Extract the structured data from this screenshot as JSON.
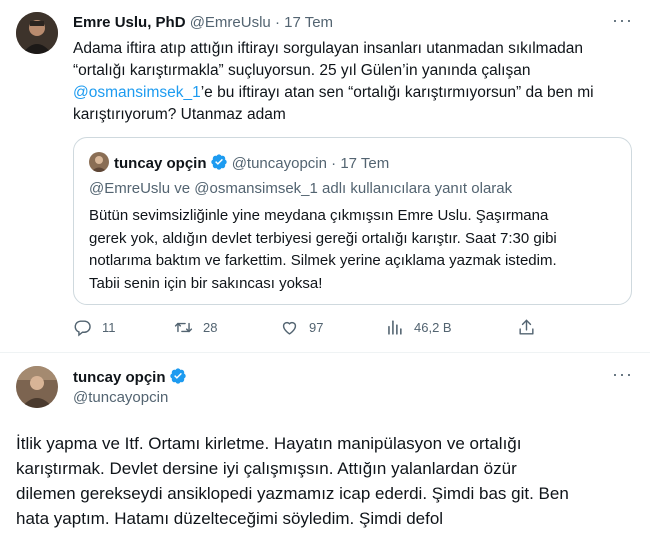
{
  "tweet": {
    "author_name": "Emre Uslu, PhD",
    "author_handle": "@EmreUslu",
    "sep": "·",
    "date": "17 Tem",
    "more": "···",
    "text_line1": "Adama iftira atıp attığın iftirayı sorgulayan insanları utanmadan sıkılmadan",
    "text_line2": "“ortalığı karıştırmakla” suçluyorsun. 25 yıl Gülen’in yanında çalışan",
    "text_mention": "@osmansimsek_1",
    "text_line3_rest": "’e bu iftirayı atan sen “ortalığı karıştırmıyorsun” da ben mi",
    "text_line4": "karıştırıyorum?  Utanmaz adam"
  },
  "quote": {
    "author_name": "tuncay opçin",
    "author_handle": "@tuncayopcin",
    "sep": "·",
    "date": "17 Tem",
    "reply_to": "@EmreUslu ve @osmansimsek_1 adlı kullanıcılara yanıt olarak",
    "line1": "Bütün sevimsizliğinle yine meydana çıkmışsın Emre Uslu. Şaşırmana",
    "line2": "gerek yok, aldığın devlet terbiyesi gereği ortalığı karıştır. Saat 7:30 gibi",
    "line3": "notlarıma baktım ve farkettim. Silmek yerine açıklama yazmak istedim.",
    "line4": "Tabii senin için bir sakıncası yoksa!"
  },
  "actions": {
    "replies": "11",
    "retweets": "28",
    "likes": "97",
    "views": "46,2 B"
  },
  "main": {
    "author_name": "tuncay opçin",
    "author_handle": "@tuncayopcin",
    "more": "···",
    "line1": "İtlik yapma ve Itf. Ortamı kirletme. Hayatın manipülasyon ve ortalığı",
    "line2": "karıştırmak. Devlet dersine iyi çalışmışsın. Attığın yalanlardan özür",
    "line3": "dilemen gerekseydi ansiklopedi yazmamız icap ederdi. Şimdi bas git. Ben",
    "line4": "hata yaptım. Hatamı düzelteceğimi söyledim. Şimdi defol"
  },
  "colors": {
    "accent": "#1d9bf0",
    "muted": "#536471",
    "border": "#cfd9de",
    "text": "#0f1419"
  }
}
